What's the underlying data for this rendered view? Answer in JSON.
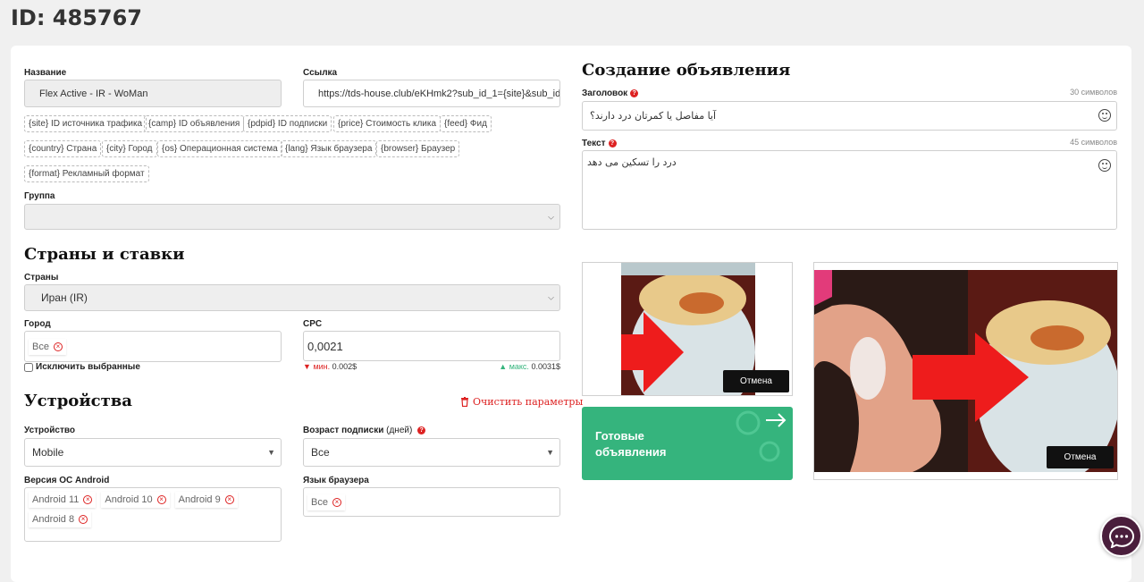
{
  "page_id": "ID: 485767",
  "form": {
    "name_label": "Название",
    "name_value": "Flex Active - IR - WoMan",
    "link_label": "Ссылка",
    "link_value": "https://tds-house.club/eKHmk2?sub_id_1={site}&sub_id_",
    "macros": [
      "{site} ID источника трафика",
      "{camp} ID объявления",
      "{pdpid} ID подписки",
      "{price} Стоимость клика",
      "{feed} Фид",
      "{country} Страна",
      "{city} Город",
      "{os} Операционная система",
      "{lang} Язык браузера",
      "{browser} Браузер",
      "{format} Рекламный формат"
    ],
    "group_label": "Группа",
    "group_value": ""
  },
  "countries": {
    "title": "Страны и ставки",
    "countries_label": "Страны",
    "country_value": "Иран (IR)",
    "city_label": "Город",
    "city_chip": "Все",
    "exclude_label": "Исключить выбранные",
    "cpc_label": "CPC",
    "cpc_value": "0,0021",
    "min_label": "мин.",
    "min_value": "0.002$",
    "max_label": "макс.",
    "max_value": "0.0031$"
  },
  "devices": {
    "title": "Устройства",
    "clear_label": "Очистить параметры",
    "device_label": "Устройство",
    "device_value": "Mobile",
    "age_label": "Возраст подписки",
    "age_unit": "(дней)",
    "age_value": "Все",
    "os_label": "Версия ОС Android",
    "os_chips": [
      "Android 11",
      "Android 10",
      "Android 9",
      "Android 8"
    ],
    "lang_label": "Язык браузера",
    "lang_chip": "Все"
  },
  "ad": {
    "title": "Создание объявления",
    "headline_label": "Заголовок",
    "headline_counter": "30 символов",
    "headline_value": "آیا مفاصل یا کمرتان درد دارند؟",
    "text_label": "Текст",
    "text_counter": "45 символов",
    "text_value": "درد را تسکین می دهد",
    "cancel_small": "Отмена",
    "cancel_large": "Отмена",
    "ready_line1": "Готовые",
    "ready_line2": "объявления"
  },
  "colors": {
    "accent_green": "#35b47d",
    "danger_red": "#d22222",
    "chat_bg": "#4a1e3c"
  },
  "icons": [
    "help-icon",
    "remove-chip-icon",
    "emoji-icon",
    "trash-icon",
    "arrow-right-icon",
    "chat-icon",
    "chevron-down-icon"
  ]
}
